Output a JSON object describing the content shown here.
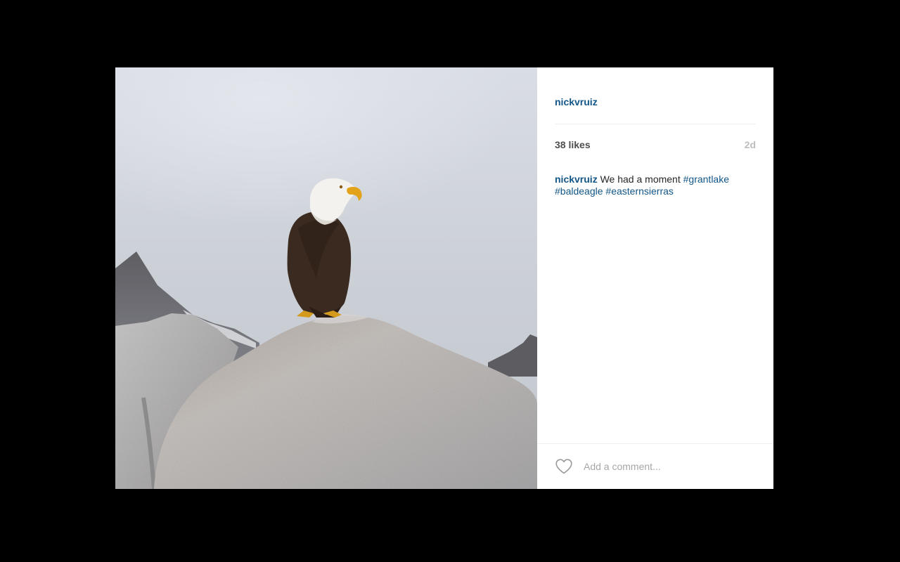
{
  "post": {
    "username": "nickvruiz",
    "likes": "38 likes",
    "time_ago": "2d",
    "caption": {
      "username": "nickvruiz",
      "text": " We had a moment ",
      "tags": [
        "#grantlake",
        "#baldeagle",
        "#easternsierras"
      ]
    }
  },
  "comment": {
    "placeholder": "Add a comment..."
  },
  "icons": {
    "like": "heart-icon"
  },
  "colors": {
    "link_blue": "#125688",
    "likes_gray": "#4d4d4d",
    "time_gray": "#bdbdbd",
    "backdrop": "#000000"
  }
}
